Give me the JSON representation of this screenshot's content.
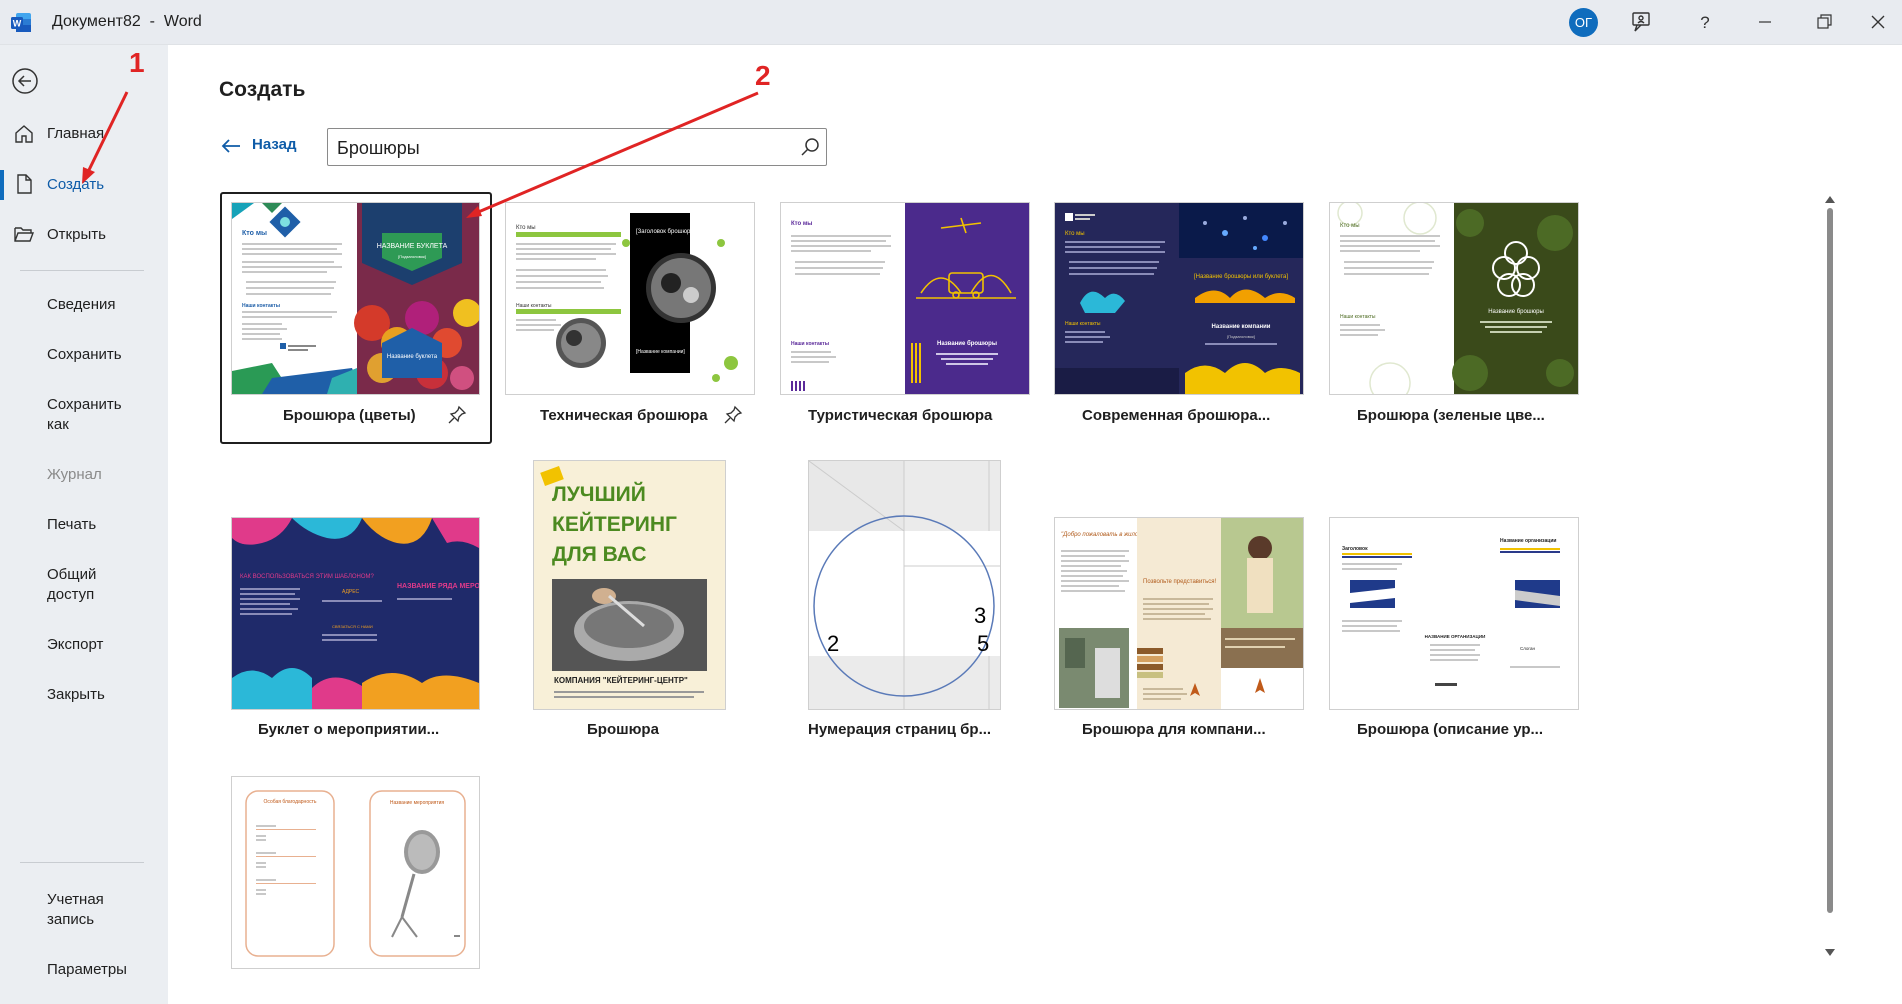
{
  "window": {
    "doc_name": "Документ82",
    "separator": "-",
    "app_name": "Word",
    "avatar_initials": "ОГ"
  },
  "sidebar": {
    "items": [
      {
        "label": "Главная",
        "icon": "home-icon"
      },
      {
        "label": "Создать",
        "icon": "new-document-icon",
        "active": true
      },
      {
        "label": "Открыть",
        "icon": "open-folder-icon"
      },
      {
        "label": "Сведения"
      },
      {
        "label": "Сохранить"
      },
      {
        "label": "Сохранить\nкак"
      },
      {
        "label": "Журнал",
        "disabled": true
      },
      {
        "label": "Печать"
      },
      {
        "label": "Общий\nдоступ"
      },
      {
        "label": "Экспорт"
      },
      {
        "label": "Закрыть"
      },
      {
        "label": "Учетная\nзапись"
      },
      {
        "label": "Параметры"
      }
    ]
  },
  "main": {
    "title": "Создать",
    "back_label": "Назад",
    "search_value": "Брошюры"
  },
  "templates": [
    {
      "label": "Брошюра (цветы)"
    },
    {
      "label": "Техническая брошюра"
    },
    {
      "label": "Туристическая брошюра"
    },
    {
      "label": "Современная брошюра..."
    },
    {
      "label": "Брошюра (зеленые цве..."
    },
    {
      "label": "Буклет о мероприятии..."
    },
    {
      "label": "Брошюра"
    },
    {
      "label": "Нумерация страниц бр..."
    },
    {
      "label": "Брошюра для компани..."
    },
    {
      "label": "Брошюра (описание ур..."
    },
    {
      "label": ""
    }
  ],
  "thumb_text": {
    "kto_my": "Кто мы",
    "booklet_name": "НАЗВАНИЕ БУКЛЕТА",
    "subtitle": "[Подзаголовок]",
    "booklet_name_2": "Название буклета",
    "contacts": "Наши контакты",
    "tech_heading": "[Заголовок брошюры]",
    "tech_company": "[Название компании]",
    "tour_name": "Название брошюры",
    "modern_name": "[Название брошюры или буклета]",
    "modern_company": "Название компании",
    "modern_sub": "[Подзаголовок]",
    "green_name": "Название брошюры",
    "event_how": "КАК ВОСПОЛЬЗОВАТЬСЯ ЭТИМ ШАБЛОНОМ?",
    "event_name": "НАЗВАНИЕ РЯДА МЕРОПРИЯТИЙ",
    "event_addr": "АДРЕС",
    "event_contact": "СВЯЗАТЬСЯ С НАМИ",
    "catering_1": "ЛУЧШИЙ",
    "catering_2": "КЕЙТЕРИНГ",
    "catering_3": "ДЛЯ ВАС",
    "catering_company": "КОМПАНИЯ \"КЕЙТЕРИНГ-ЦЕНТР\"",
    "num_2": "2",
    "num_3": "3",
    "num_5": "5",
    "company_welcome": "\"Добро пожаловать в жилой район\"",
    "company_intro": "Позвольте представиться!",
    "desc_heading": "Заголовок",
    "desc_org": "Название организации",
    "desc_org_center": "НАЗВАНИЕ ОРГАНИЗАЦИИ",
    "desc_slogan": "Слоган",
    "party_thanks": "Особая благодарность",
    "party_event": "Название мероприятия"
  },
  "annotations": {
    "one": "1",
    "two": "2"
  },
  "colors": {
    "accent": "#0f6cbd",
    "annotation": "#e02424"
  }
}
